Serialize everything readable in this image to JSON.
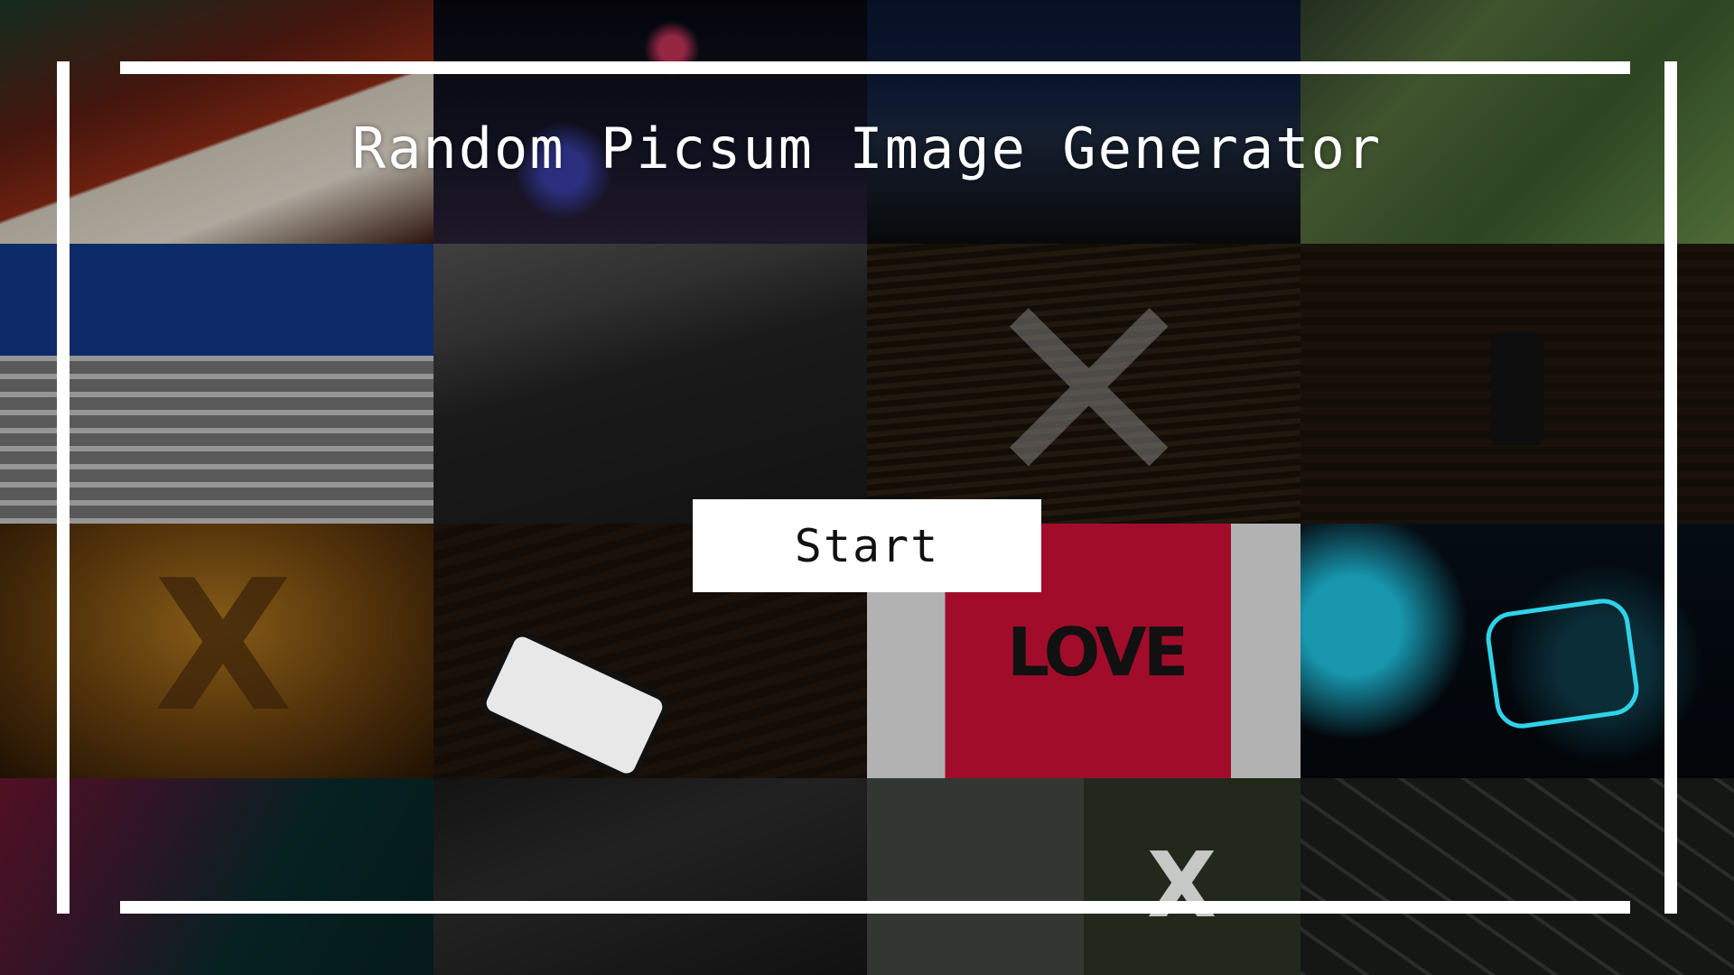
{
  "app": {
    "title": "Random Picsum Image Generator"
  },
  "controls": {
    "start_label": "Start"
  },
  "background_images": [
    {
      "name": "temple-banner-image"
    },
    {
      "name": "night-fireworks-image"
    },
    {
      "name": "night-city-image"
    },
    {
      "name": "palm-leaves-image"
    },
    {
      "name": "building-facade-image"
    },
    {
      "name": "church-hillside-image"
    },
    {
      "name": "wood-x-image"
    },
    {
      "name": "phone-on-wood-image"
    },
    {
      "name": "amber-x-image"
    },
    {
      "name": "phone-on-desk-image"
    },
    {
      "name": "love-card-image"
    },
    {
      "name": "neon-face-image"
    },
    {
      "name": "iphone-gradient-image"
    },
    {
      "name": "car-phone-image"
    },
    {
      "name": "tree-x-image"
    },
    {
      "name": "highway-aerial-image"
    }
  ],
  "colors": {
    "frame": "#ffffff",
    "title_text": "#ffffff",
    "button_bg": "#ffffff",
    "button_text": "#111111"
  }
}
